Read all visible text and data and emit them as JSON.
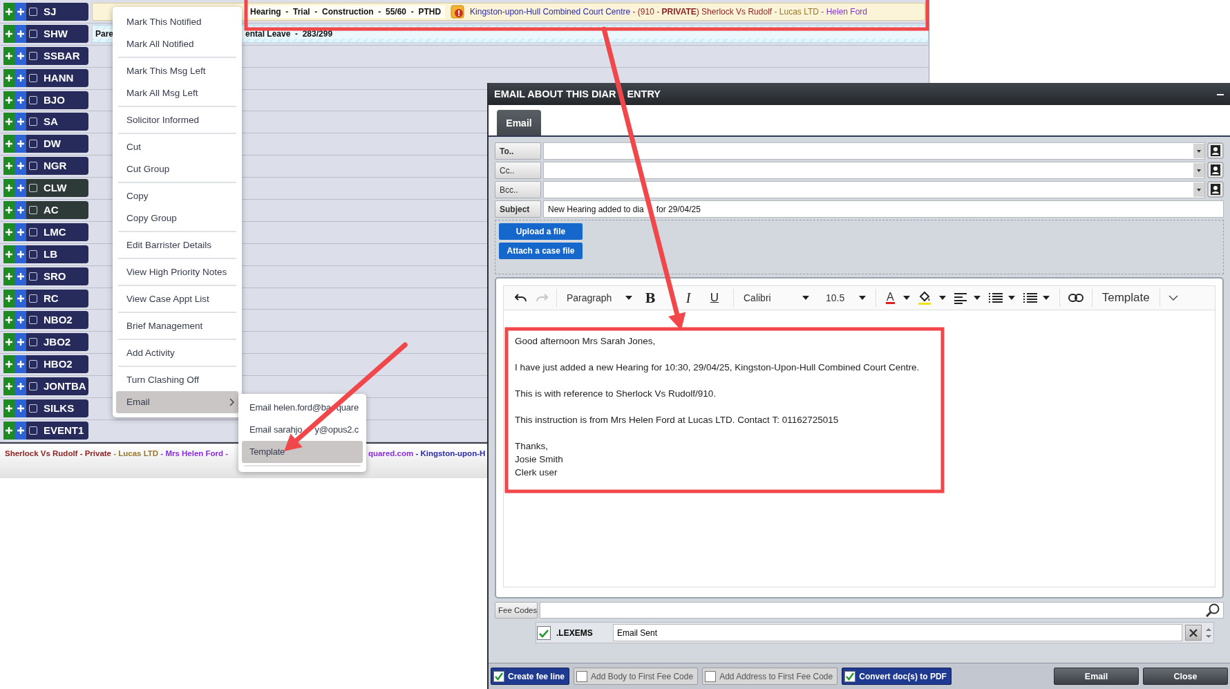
{
  "diary": {
    "rows": [
      {
        "code": "SJ",
        "color": "#262b5c",
        "checked": false,
        "entry": {
          "kind": "appointment",
          "summary": "Hearing  -  Trial  -  Construction  -  55/60  -  PTHD",
          "segments": [
            {
              "text": "Kingston-upon-Hull Combined Court Centre",
              "color": "#2a2aa8"
            },
            {
              "text": " - (910 - **PRIVATE**) Sherlock Vs Rudolf",
              "color": "#8e1f1f"
            },
            {
              "text": " - Lucas LTD",
              "color": "#97762a"
            },
            {
              "text": " - Helen Ford",
              "color": "#8a2be2"
            }
          ]
        }
      },
      {
        "code": "SHW",
        "color": "#262b5c",
        "checked": false,
        "entry": {
          "kind": "leave",
          "parts": [
            "Pare",
            "ental Leave  -  283/299"
          ]
        }
      },
      {
        "code": "SSBAR",
        "color": "#262b5c",
        "checked": false
      },
      {
        "code": "HANN",
        "color": "#262b5c",
        "checked": false
      },
      {
        "code": "BJO",
        "color": "#262b5c",
        "checked": false
      },
      {
        "code": "SA",
        "color": "#262b5c",
        "checked": false
      },
      {
        "code": "DW",
        "color": "#262b5c",
        "checked": false
      },
      {
        "code": "NGR",
        "color": "#262b5c",
        "checked": false
      },
      {
        "code": "CLW",
        "color": "#2d3a37",
        "checked": false
      },
      {
        "code": "AC",
        "color": "#2d3a37",
        "checked": false
      },
      {
        "code": "LMC",
        "color": "#262b5c",
        "checked": false
      },
      {
        "code": "LB",
        "color": "#262b5c",
        "checked": false
      },
      {
        "code": "SRO",
        "color": "#262b5c",
        "checked": false
      },
      {
        "code": "RC",
        "color": "#262b5c",
        "checked": false
      },
      {
        "code": "NBO2",
        "color": "#262b5c",
        "checked": false
      },
      {
        "code": "JBO2",
        "color": "#262b5c",
        "checked": false
      },
      {
        "code": "HBO2",
        "color": "#262b5c",
        "checked": false
      },
      {
        "code": "JONTBA",
        "color": "#262b5c",
        "checked": false
      },
      {
        "code": "SILKS",
        "color": "#262b5c",
        "checked": false
      },
      {
        "code": "EVENT1",
        "color": "#262b5c",
        "checked": false
      }
    ],
    "case_line": {
      "left": [
        {
          "text": "Sherlock Vs Rudolf",
          "color": "#8e1f1f"
        },
        {
          "text": " - Private",
          "color": "#8e1f1f"
        },
        {
          "text": " - Lucas LTD",
          "color": "#97762a"
        },
        {
          "text": " - Mrs Helen Ford -",
          "color": "#8a2be2"
        }
      ],
      "right": [
        {
          "text": "quared.com",
          "color": "#8a2be2"
        },
        {
          "text": " - Kingston-upon-H",
          "color": "#2a2aa8"
        }
      ]
    }
  },
  "context_menu": {
    "groups": [
      [
        {
          "label": "Mark This Notified",
          "selected": false,
          "submenu": false
        },
        {
          "label": "Mark All Notified",
          "selected": false,
          "submenu": false
        }
      ],
      [
        {
          "label": "Mark This Msg Left",
          "selected": false,
          "submenu": false
        },
        {
          "label": "Mark All Msg Left",
          "selected": false,
          "submenu": false
        }
      ],
      [
        {
          "label": "Solicitor Informed",
          "selected": false,
          "submenu": false
        }
      ],
      [
        {
          "label": "Cut",
          "selected": false,
          "submenu": false
        },
        {
          "label": "Cut Group",
          "selected": false,
          "submenu": false
        }
      ],
      [
        {
          "label": "Copy",
          "selected": false,
          "submenu": false
        },
        {
          "label": "Copy Group",
          "selected": false,
          "submenu": false
        }
      ],
      [
        {
          "label": "Edit Barrister Details",
          "selected": false,
          "submenu": false
        }
      ],
      [
        {
          "label": "View High Priority Notes",
          "selected": false,
          "submenu": false
        }
      ],
      [
        {
          "label": "View Case Appt List",
          "selected": false,
          "submenu": false
        }
      ],
      [
        {
          "label": "Brief Management",
          "selected": false,
          "submenu": false
        }
      ],
      [
        {
          "label": "Add Activity",
          "selected": false,
          "submenu": false
        }
      ],
      [
        {
          "label": "Turn Clashing Off",
          "selected": false,
          "submenu": false
        },
        {
          "label": "Email",
          "selected": true,
          "submenu": true
        }
      ]
    ],
    "submenu": [
      {
        "label_parts": [
          "Email helen.ford@ba",
          "quare"
        ],
        "selected": false
      },
      {
        "label_parts": [
          "Email sarahjo",
          "y@opus2.c"
        ],
        "selected": false
      },
      {
        "label_parts": [
          "Template"
        ],
        "selected": true
      }
    ]
  },
  "dialog": {
    "title_parts": [
      "EMAIL ABOUT THIS DIAR",
      "ENTRY"
    ],
    "tabs": [
      {
        "label": "Email",
        "selected": true
      }
    ],
    "fields": [
      {
        "kind": "recipient",
        "label": "To..",
        "required": true
      },
      {
        "kind": "recipient",
        "label": "Cc..",
        "required": false
      },
      {
        "kind": "recipient",
        "label": "Bcc..",
        "required": false
      },
      {
        "kind": "subject",
        "label": "Subject",
        "required": true,
        "value_parts": [
          "New Hearing added to dia",
          "for 29/04/25"
        ]
      }
    ],
    "attach_buttons": [
      "Upload a file",
      "Attach a case file"
    ],
    "toolbar": {
      "undo_disabled": false,
      "redo_disabled": true,
      "block_format": "Paragraph",
      "bold": "B",
      "italic": "I",
      "underline": "U",
      "font": "Calibri",
      "font_size": "10.5",
      "text_color": "A",
      "template": "Template"
    },
    "body": [
      [
        "Good afternoon Mrs Sarah Jones,"
      ],
      [
        "I have just added a new Hearing for 10:30, 29/04/25, Kingston-Upon-Hull Combined Court Centre."
      ],
      [
        "This is with reference to Sherlock Vs Rudolf/910."
      ],
      [
        "This instruction is from Mrs Helen Ford at Lucas LTD. Contact T: 01162725015"
      ],
      [
        "Thanks,",
        "Josie Smith",
        "Clerk user"
      ]
    ],
    "fee_codes": {
      "label": "Fee Codes",
      "lines": [
        {
          "checked": true,
          "code": ".LEXEMS",
          "description": "Email Sent"
        }
      ]
    },
    "options": [
      {
        "label": "Create fee line",
        "checked": true
      },
      {
        "label": "Add Body to First Fee Code",
        "checked": false
      },
      {
        "label": "Add Address to First Fee Code",
        "checked": false
      },
      {
        "label": "Convert doc(s) to PDF",
        "checked": true
      }
    ],
    "buttons": [
      "Email",
      "Close"
    ]
  }
}
